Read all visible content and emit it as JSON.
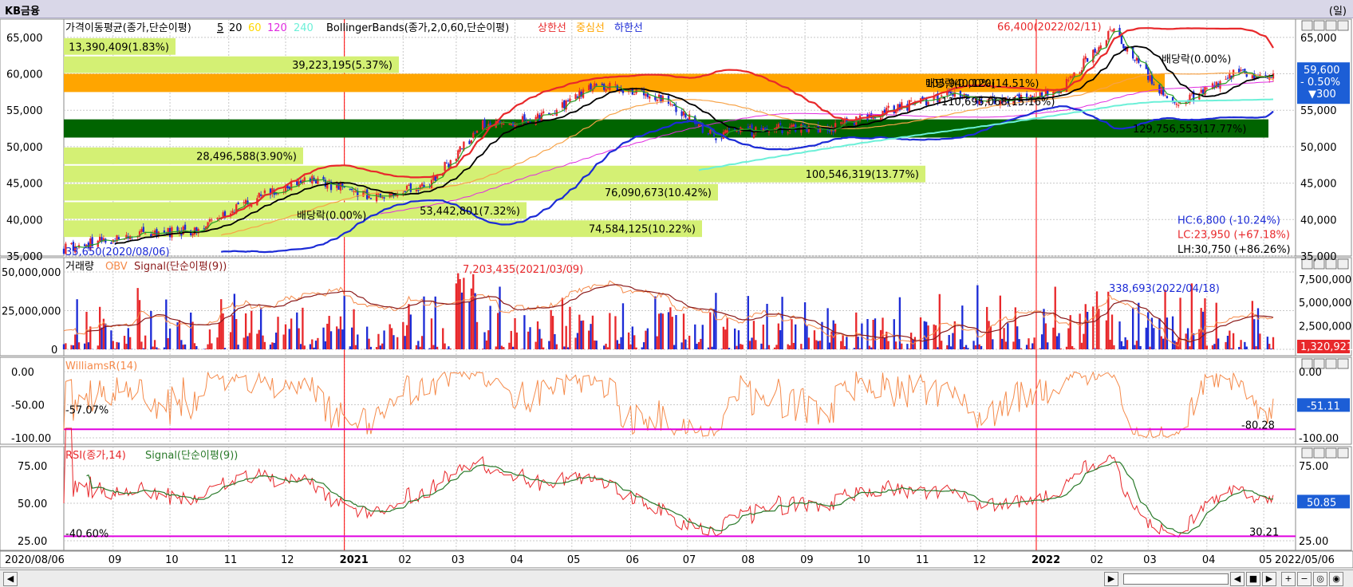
{
  "window": {
    "title": "KB금융",
    "period": "(일)"
  },
  "legends": {
    "price": {
      "ma_title": "가격이동평균(종가,단순이평)",
      "ma_periods": [
        "5",
        "20",
        "60",
        "120",
        "240"
      ],
      "bb_title": "BollingerBands(종가,2,0,60,단순이평)",
      "upper": "상한선",
      "middle": "중심선",
      "lower": "하한선"
    },
    "volume": {
      "title": "거래량",
      "obv": "OBV",
      "signal": "Signal(단순이평(9))"
    },
    "williams": {
      "title": "WilliamsR(14)"
    },
    "rsi": {
      "title": "RSI(종가,14)",
      "signal": "Signal(단순이평(9))"
    }
  },
  "colors": {
    "up": "#e8282b",
    "down": "#1c2bd6",
    "ma5": "#27a027",
    "ma20": "#000000",
    "ma60": "#f7a348",
    "ma120": "#e02ae0",
    "ma240": "#6cf0d8",
    "bb_upper": "#e8282b",
    "bb_lower": "#1c2bd6",
    "profile": "#d4f074",
    "band_orange": "#ffa500",
    "band_green": "#006400",
    "obv": "#f58a4a",
    "obv_signal": "#8b1a1a",
    "williams": "#f58a4a",
    "rsi": "#e8282b",
    "rsi_signal": "#2a7a2a",
    "ref_line": "#e000e0"
  },
  "chart_data": [
    {
      "type": "candlestick",
      "title": "KB금융",
      "x_start": "2020/08/06",
      "x_end": "2022/05/06",
      "x_ticks": [
        "09",
        "10",
        "11",
        "12",
        "2021",
        "02",
        "03",
        "04",
        "05",
        "06",
        "07",
        "08",
        "09",
        "10",
        "11",
        "12",
        "2022",
        "02",
        "03",
        "04",
        "05"
      ],
      "ylim": [
        35000,
        67500
      ],
      "y_ticks": [
        "35,000",
        "40,000",
        "45,000",
        "50,000",
        "55,000",
        "60,000",
        "65,000"
      ],
      "close_monthly": [
        {
          "date": "2020/08",
          "close": 36000
        },
        {
          "date": "2020/09",
          "close": 38000
        },
        {
          "date": "2020/10",
          "close": 38500
        },
        {
          "date": "2020/11",
          "close": 43000
        },
        {
          "date": "2020/12",
          "close": 45500
        },
        {
          "date": "2021/01",
          "close": 43000
        },
        {
          "date": "2021/02",
          "close": 45000
        },
        {
          "date": "2021/03",
          "close": 53000
        },
        {
          "date": "2021/04",
          "close": 54000
        },
        {
          "date": "2021/05",
          "close": 58500
        },
        {
          "date": "2021/06",
          "close": 57000
        },
        {
          "date": "2021/07",
          "close": 51500
        },
        {
          "date": "2021/08",
          "close": 52500
        },
        {
          "date": "2021/09",
          "close": 52500
        },
        {
          "date": "2021/10",
          "close": 55000
        },
        {
          "date": "2021/11",
          "close": 57000
        },
        {
          "date": "2021/12",
          "close": 56000
        },
        {
          "date": "2022/01",
          "close": 58000
        },
        {
          "date": "2022/02",
          "close": 64000
        },
        {
          "date": "2022/03",
          "close": 55500
        },
        {
          "date": "2022/04",
          "close": 60000
        },
        {
          "date": "2022/05",
          "close": 59600
        }
      ],
      "current": {
        "price": "59,600",
        "change_pct": "- 0.50%",
        "change": "▼300"
      },
      "annotations": [
        "66,400(2022/02/11)",
        "35,650(2020/08/06)",
        "배당락(0.00%)",
        "배당락(0.00%)",
        "배당락(0.00%)"
      ],
      "stats": [
        "HC:6,800 (-10.24%)",
        "LC:23,950 (+67.18%)",
        "LH:30,750 (+86.26%)"
      ],
      "volume_profile": [
        {
          "label": "13,390,409(1.83%)",
          "price": 63750
        },
        {
          "label": "39,223,195(5.37%)",
          "price": 61250
        },
        {
          "label": "",
          "price": 58750
        },
        {
          "label": "",
          "price": 56250
        },
        {
          "label": "105,940,120(14.51%)",
          "price": 58750
        },
        {
          "label": "110,695,068(15.16%)",
          "price": 56250
        },
        {
          "label": "129,756,553(17.77%)",
          "price": 52500
        },
        {
          "label": "28,496,588(3.90%)",
          "price": 48750
        },
        {
          "label": "100,546,319(13.77%)",
          "price": 46250
        },
        {
          "label": "76,090,673(10.42%)",
          "price": 43750
        },
        {
          "label": "53,442,801(7.32%)",
          "price": 41250
        },
        {
          "label": "74,584,125(10.22%)",
          "price": 38750
        }
      ]
    },
    {
      "type": "bar",
      "title": "거래량",
      "y_ticks_left": [
        "0",
        "25,000,000",
        "50,000,000"
      ],
      "y_ticks_right": [
        "2,500,000",
        "5,000,000",
        "7,500,000"
      ],
      "annotations": [
        "7,203,435(2021/03/09)",
        "338,693(2022/04/18)"
      ],
      "last_value": "1,320,921"
    },
    {
      "type": "line",
      "title": "WilliamsR(14)",
      "ylim": [
        -100,
        0
      ],
      "y_ticks": [
        "0.00",
        "-50.00",
        "-100.00"
      ],
      "left_value": "-57.07%",
      "last_value": "-51.11",
      "ref_label": "-80.28"
    },
    {
      "type": "line",
      "title": "RSI(종가,14)",
      "ylim": [
        25,
        75
      ],
      "y_ticks": [
        "75.00",
        "50.00",
        "25.00"
      ],
      "left_value": "-40.60%",
      "last_value": "50.85",
      "ref_label": "30.21"
    }
  ],
  "axis": {
    "x_start_label": "2020/08/06",
    "x_end_label": "2022/05/06"
  }
}
